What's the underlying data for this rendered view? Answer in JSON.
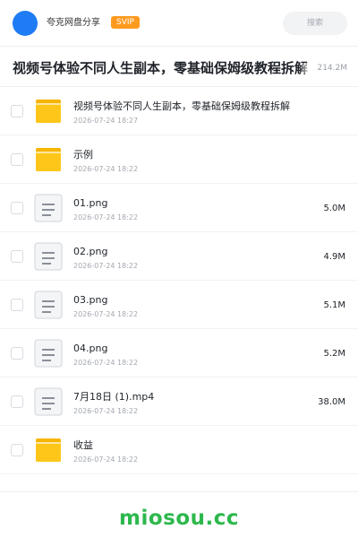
{
  "header": {
    "share_name": "夸克网盘分享",
    "badge": "SVIP",
    "search_placeholder": "搜索",
    "accent": "#1f7cf4"
  },
  "folder": {
    "title": "视频号体验不同人生副本，零基础保姆级教程拆解",
    "size": "214.2M"
  },
  "files": [
    {
      "name": "视频号体验不同人生副本，零基础保姆级教程拆解",
      "date": "2026-07-24 18:27",
      "size": "",
      "type": "folder-icon"
    },
    {
      "name": "示例",
      "date": "2026-07-24 18:22",
      "size": "",
      "type": "folder-icon"
    },
    {
      "name": "01.png",
      "date": "2026-07-24 18:22",
      "size": "5.0M",
      "type": "file-icon"
    },
    {
      "name": "02.png",
      "date": "2026-07-24 18:22",
      "size": "4.9M",
      "type": "file-icon"
    },
    {
      "name": "03.png",
      "date": "2026-07-24 18:22",
      "size": "5.1M",
      "type": "file-icon"
    },
    {
      "name": "04.png",
      "date": "2026-07-24 18:22",
      "size": "5.2M",
      "type": "file-icon"
    },
    {
      "name": "7月18日 (1).mp4",
      "date": "2026-07-24 18:22",
      "size": "38.0M",
      "type": "file-icon"
    },
    {
      "name": "收益",
      "date": "2026-07-24 18:22",
      "size": "",
      "type": "folder-icon"
    }
  ],
  "watermark": "miosou.cc"
}
